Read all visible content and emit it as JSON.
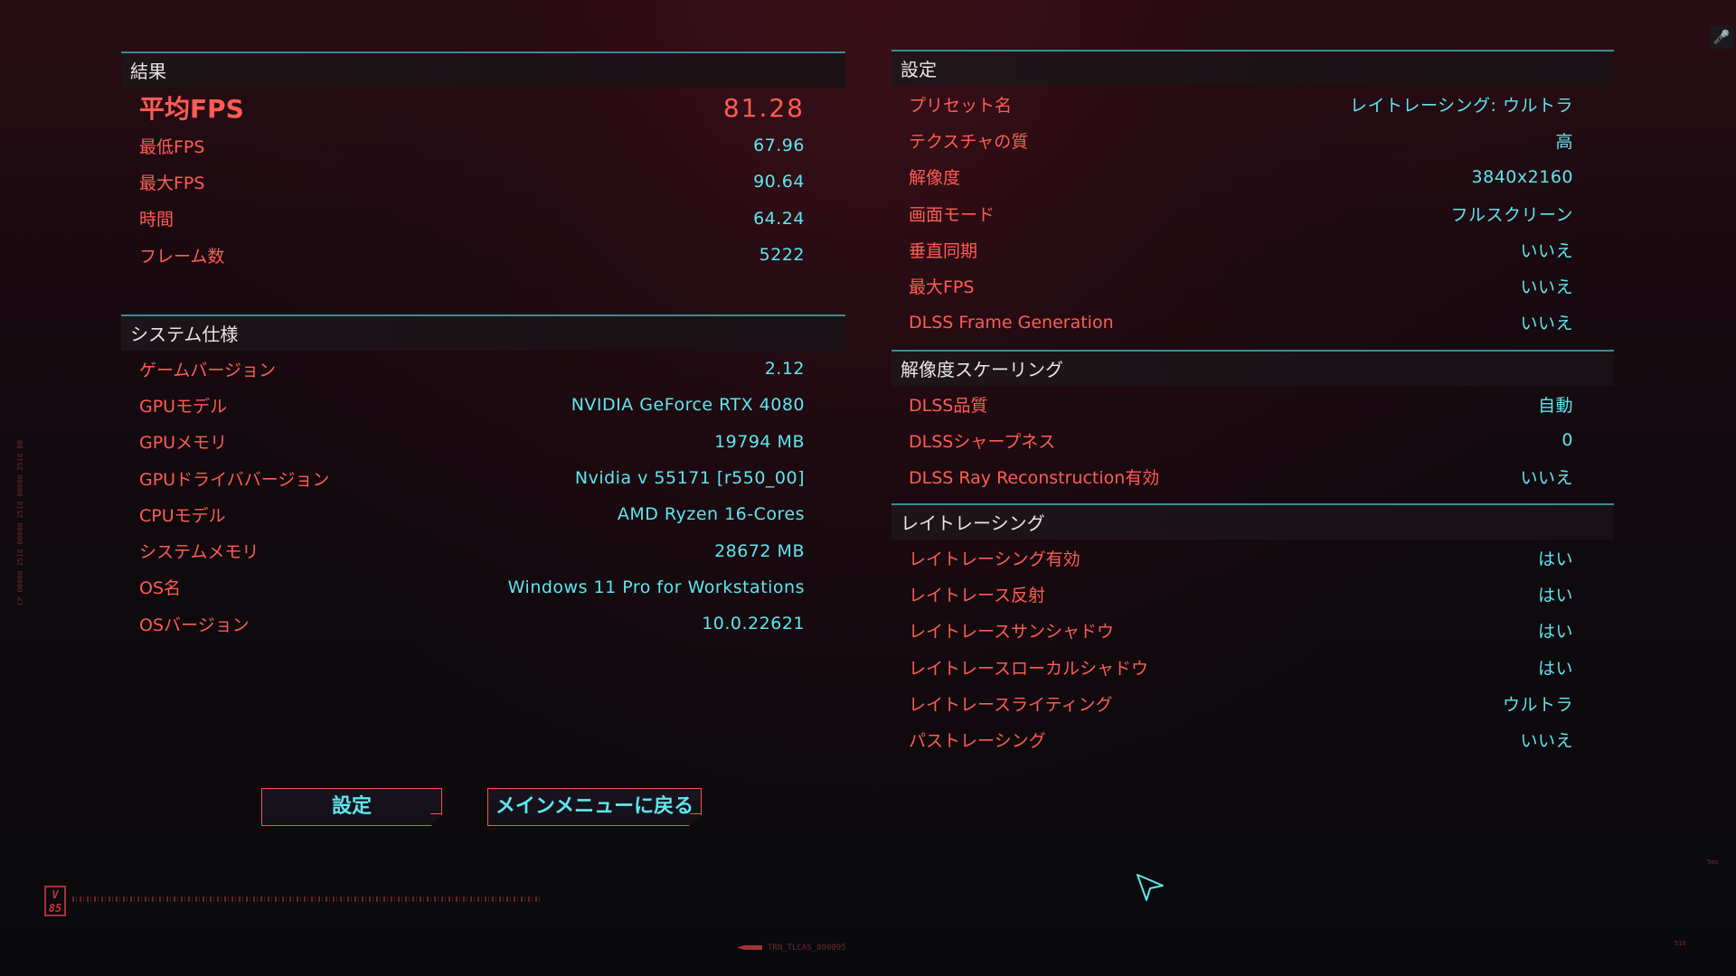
{
  "results": {
    "header": "結果",
    "avg_fps": {
      "label": "平均FPS",
      "value": "81.28"
    },
    "rows": [
      {
        "label": "最低FPS",
        "value": "67.96"
      },
      {
        "label": "最大FPS",
        "value": "90.64"
      },
      {
        "label": "時間",
        "value": "64.24"
      },
      {
        "label": "フレーム数",
        "value": "5222"
      }
    ]
  },
  "system": {
    "header": "システム仕様",
    "rows": [
      {
        "label": "ゲームバージョン",
        "value": "2.12"
      },
      {
        "label": "GPUモデル",
        "value": "NVIDIA GeForce RTX 4080"
      },
      {
        "label": "GPUメモリ",
        "value": "19794 MB"
      },
      {
        "label": "GPUドライババージョン",
        "value": "Nvidia v 55171 [r550_00]"
      },
      {
        "label": "CPUモデル",
        "value": "AMD Ryzen 16-Cores"
      },
      {
        "label": "システムメモリ",
        "value": "28672 MB"
      },
      {
        "label": "OS名",
        "value": "Windows 11 Pro for Workstations"
      },
      {
        "label": "OSバージョン",
        "value": "10.0.22621"
      }
    ]
  },
  "settings": {
    "header": "設定",
    "rows": [
      {
        "label": "プリセット名",
        "value": "レイトレーシング: ウルトラ"
      },
      {
        "label": "テクスチャの質",
        "value": "高"
      },
      {
        "label": "解像度",
        "value": "3840x2160"
      },
      {
        "label": "画面モード",
        "value": "フルスクリーン"
      },
      {
        "label": "垂直同期",
        "value": "いいえ"
      },
      {
        "label": "最大FPS",
        "value": "いいえ"
      },
      {
        "label": "DLSS Frame Generation",
        "value": "いいえ"
      }
    ]
  },
  "scaling": {
    "header": "解像度スケーリング",
    "rows": [
      {
        "label": "DLSS品質",
        "value": "自動"
      },
      {
        "label": "DLSSシャープネス",
        "value": "0"
      },
      {
        "label": "DLSS Ray Reconstruction有効",
        "value": "いいえ"
      }
    ]
  },
  "raytracing": {
    "header": "レイトレーシング",
    "rows": [
      {
        "label": "レイトレーシング有効",
        "value": "はい"
      },
      {
        "label": "レイトレース反射",
        "value": "はい"
      },
      {
        "label": "レイトレースサンシャドウ",
        "value": "はい"
      },
      {
        "label": "レイトレースローカルシャドウ",
        "value": "はい"
      },
      {
        "label": "レイトレースライティング",
        "value": "ウルトラ"
      },
      {
        "label": "パストレーシング",
        "value": "いいえ"
      }
    ]
  },
  "buttons": {
    "settings": "設定",
    "main_menu": "メインメニューに戻る"
  },
  "decor": {
    "badge": "V 85",
    "footer_code": "TRN_TLCAS_800095",
    "vertical_code": "CP 00000 2518 00000 2518 00000 2518 00",
    "corner_code_1": "5ms",
    "corner_code_2": "516"
  },
  "icons": {
    "mic": "microphone-icon",
    "cursor": "pointer-cursor-icon"
  },
  "colors": {
    "label": "#ff5c54",
    "value": "#5fe6ee",
    "accent_line": "#3a8d96",
    "header_text": "#e6e6e6"
  }
}
